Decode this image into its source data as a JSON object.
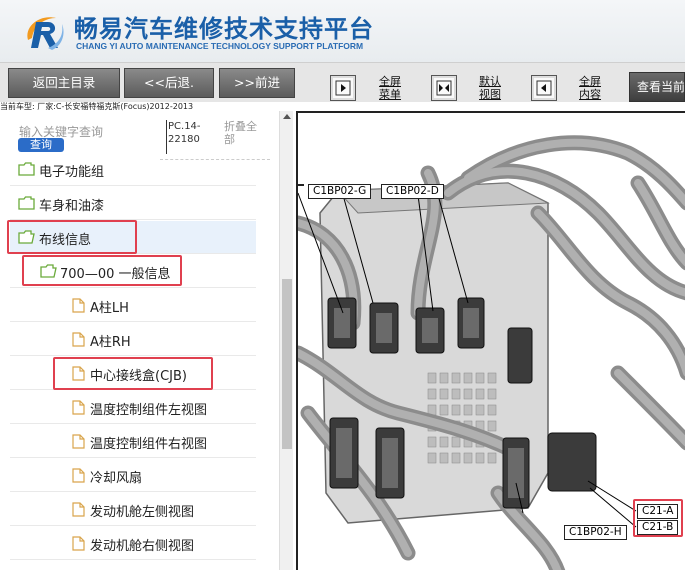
{
  "header": {
    "title": "畅易汽车维修技术支持平台",
    "subtitle": "CHANG YI AUTO MAINTENANCE TECHNOLOGY SUPPORT PLATFORM",
    "colors": {
      "brand_blue": "#1a5fa8",
      "logo_orange": "#f29a1f"
    }
  },
  "toolbar": {
    "back_main": "返回主目录",
    "back": "<<后退.",
    "forward": ">>前进",
    "fullscreen_menu_l1": "全屏",
    "fullscreen_menu_l2": "菜单",
    "default_view_l1": "默认",
    "default_view_l2": "视图",
    "fullscreen_content_l1": "全屏",
    "fullscreen_content_l2": "内容",
    "view_current": "查看当前"
  },
  "info_line": "当前车型: 厂家:C-长安福特福克斯(Focus)2012-2013",
  "sidebar": {
    "search_placeholder": "输入关键字查询",
    "query_button": "查询",
    "pc_code_l1": "PC.14-",
    "pc_code_l2": "22180",
    "fold_all_l1": "折叠全",
    "fold_all_l2": "部",
    "items": [
      {
        "label": "电子功能组"
      },
      {
        "label": "车身和油漆"
      },
      {
        "label": "布线信息"
      },
      {
        "label": "700—00 一般信息"
      },
      {
        "label": "A柱LH"
      },
      {
        "label": "A柱RH"
      },
      {
        "label": "中心接线盒(CJB)"
      },
      {
        "label": "温度控制组件左视图"
      },
      {
        "label": "温度控制组件右视图"
      },
      {
        "label": "冷却风扇"
      },
      {
        "label": "发动机舱左侧视图"
      },
      {
        "label": "发动机舱右侧视图"
      }
    ]
  },
  "diagram": {
    "callouts": {
      "g": "C1BP02-G",
      "d": "C1BP02-D",
      "h": "C1BP02-H",
      "a": "C21-A",
      "b": "C21-B"
    },
    "highlight_color": "#e0404f"
  }
}
